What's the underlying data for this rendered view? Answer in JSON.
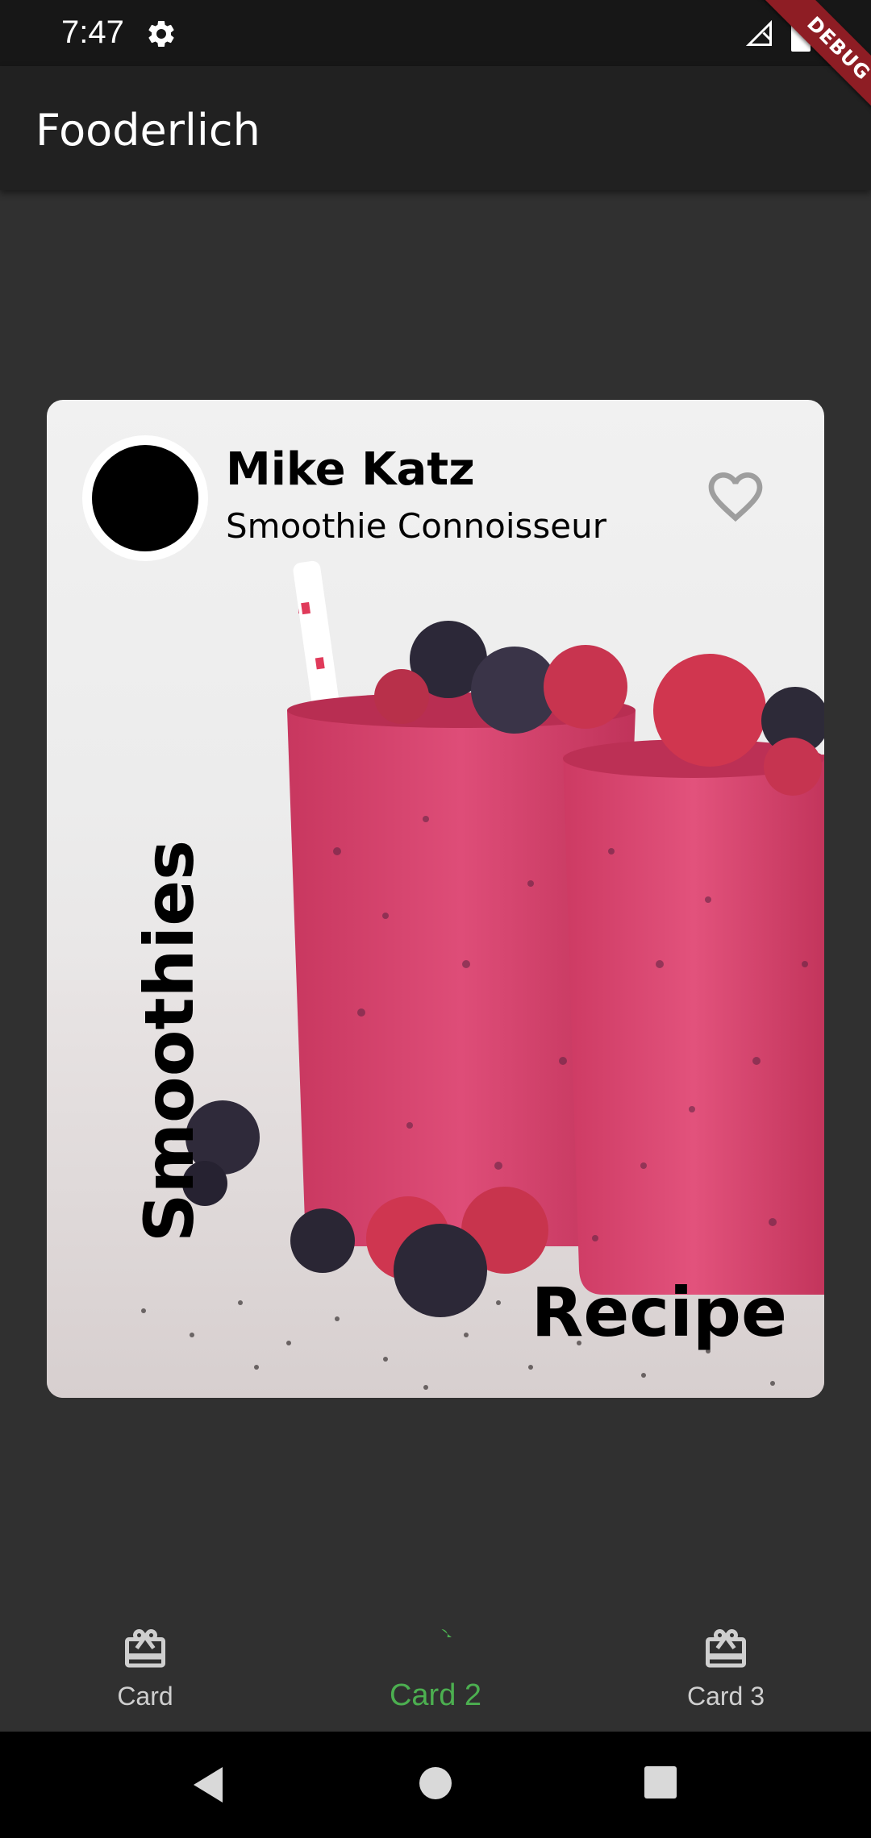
{
  "status_bar": {
    "time": "7:47",
    "icons": [
      "gear-icon",
      "signal-icon",
      "battery-icon"
    ]
  },
  "debug_banner": {
    "label": "DEBUG",
    "color": "#8e1d24"
  },
  "app_bar": {
    "title": "Fooderlich"
  },
  "card": {
    "author_name": "Mike Katz",
    "author_title": "Smoothie Connoisseur",
    "vertical_title": "Smoothies",
    "label": "Recipe",
    "favorite_icon": "heart-outline-icon"
  },
  "bottom_nav": {
    "active_color": "#4caf50",
    "inactive_color": "#cfcfcf",
    "items": [
      {
        "label": "Card",
        "icon": "card-giftcard-icon",
        "active": false
      },
      {
        "label": "Card 2",
        "icon": "card-giftcard-icon",
        "active": true
      },
      {
        "label": "Card 3",
        "icon": "card-giftcard-icon",
        "active": false
      }
    ]
  },
  "system_nav": {
    "buttons": [
      "back-icon",
      "home-icon",
      "recents-icon"
    ]
  }
}
